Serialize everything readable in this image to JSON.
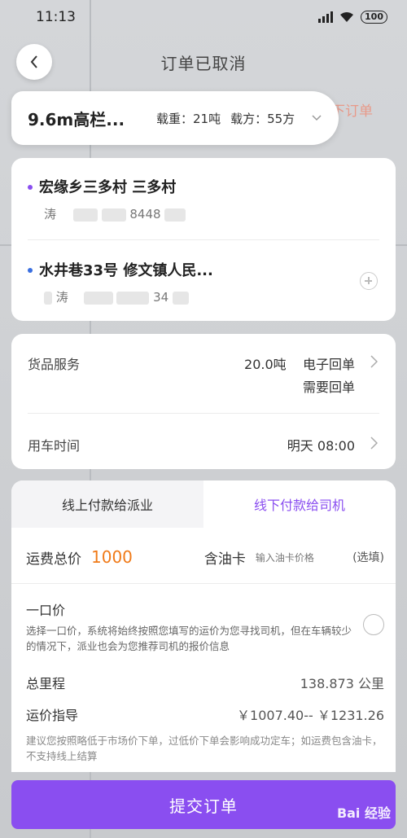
{
  "status_bar": {
    "time": "11:13",
    "battery": "100"
  },
  "header": {
    "title": "订单已取消",
    "behind_text": "下订单"
  },
  "vehicle": {
    "name": "9.6m高栏...",
    "load": "载重：21吨",
    "volume": "载方：55方"
  },
  "route": {
    "stops": [
      {
        "address": "宏缘乡三多村 三多村",
        "contact_prefix": "涛",
        "contact_phone": "8448"
      },
      {
        "address": "水井巷33号 修文镇人民...",
        "contact_prefix": "涛",
        "contact_phone": "34"
      }
    ]
  },
  "info": {
    "goods_label": "货品服务",
    "goods_value_1": "20.0吨    电子回单",
    "goods_value_2": "需要回单",
    "time_label": "用车时间",
    "time_value": "明天 08:00"
  },
  "payment": {
    "tab_online": "线上付款给派业",
    "tab_offline": "线下付款给司机",
    "fee_label": "运费总价",
    "fee_value": "1000",
    "oil_label": "含油卡",
    "oil_placeholder": "输入油卡价格",
    "optional": "(选填)",
    "fixed_title": "一口价",
    "fixed_desc": "选择一口价，系统将始终按照您填写的运价为您寻找司机，但在车辆较少的情况下，派业也会为您推荐司机的报价信息",
    "distance_label": "总里程",
    "distance_value": "138.873 公里",
    "guide_label": "运价指导",
    "guide_value": "￥1007.40-- ￥1231.26",
    "tip": "建议您按照略低于市场价下单，过低价下单会影响成功定车；如运费包含油卡，不支持线上结算"
  },
  "submit_label": "提交订单",
  "watermark": "Bai 经验",
  "colors": {
    "accent": "#8a4ef0",
    "fee": "#f07a18",
    "dot_blue": "#3a6fe0"
  }
}
